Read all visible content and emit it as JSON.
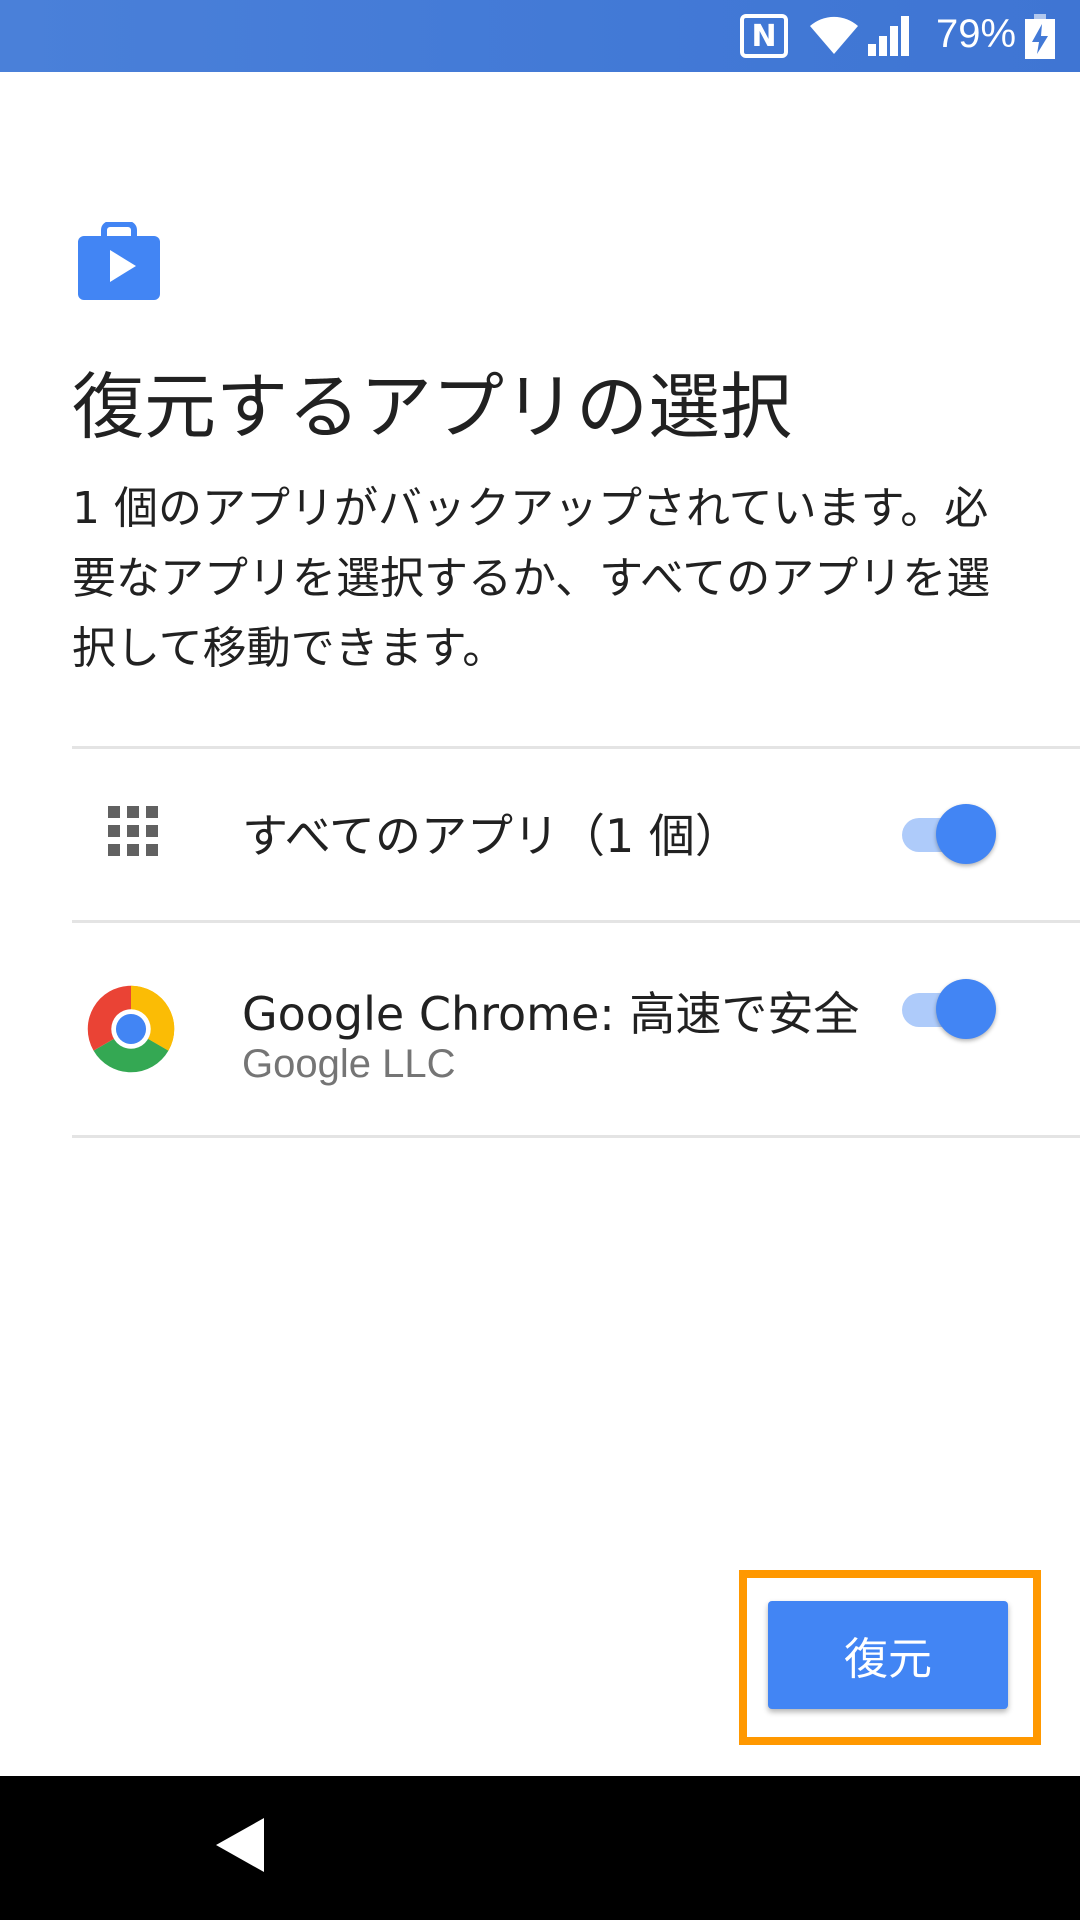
{
  "status_bar": {
    "battery_percent": "79%",
    "icons": [
      "nfc-icon",
      "wifi-icon",
      "signal-icon",
      "battery-charging-icon"
    ],
    "nfc_glyph": "N"
  },
  "header": {
    "icon": "play-store-bag-icon",
    "title": "復元するアプリの選択",
    "description": "1 個のアプリがバックアップされています。必要なアプリを選択するか、すべてのアプリを選択して移動できます。"
  },
  "apps": {
    "all_apps": {
      "label": "すべてのアプリ（1 個）",
      "enabled": true,
      "icon": "apps-grid-icon"
    },
    "items": [
      {
        "name": "Google Chrome: 高速で安全",
        "developer": "Google LLC",
        "enabled": true,
        "icon": "chrome-icon"
      }
    ]
  },
  "actions": {
    "restore_label": "復元"
  },
  "nav_bar": {
    "back": "back-icon"
  },
  "colors": {
    "accent": "#4285f4",
    "status_bar": "#4279d6",
    "highlight": "#ff9800",
    "track": "#aecbfa"
  }
}
